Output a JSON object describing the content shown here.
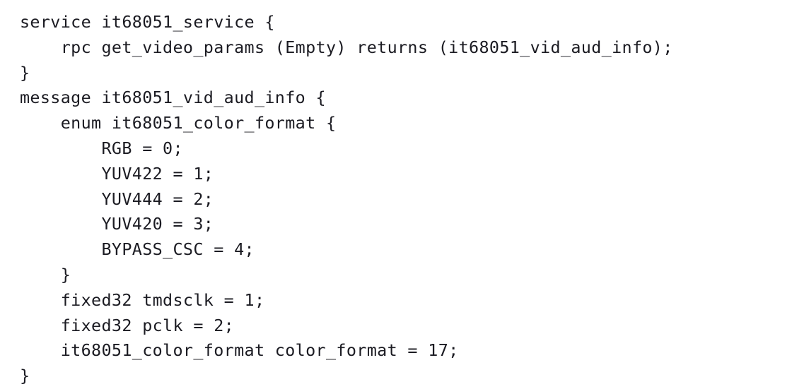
{
  "document": {
    "kind": "code-listing",
    "language": "protobuf",
    "background_color": "#ffffff",
    "text_color": "#1b1b22",
    "lines": [
      "service it68051_service {",
      "    rpc get_video_params (Empty) returns (it68051_vid_aud_info);",
      "}",
      "message it68051_vid_aud_info {",
      "    enum it68051_color_format {",
      "        RGB = 0;",
      "        YUV422 = 1;",
      "        YUV444 = 2;",
      "        YUV420 = 3;",
      "        BYPASS_CSC = 4;",
      "    }",
      "    fixed32 tmdsclk = 1;",
      "    fixed32 pclk = 2;",
      "    it68051_color_format color_format = 17;",
      "}"
    ]
  }
}
